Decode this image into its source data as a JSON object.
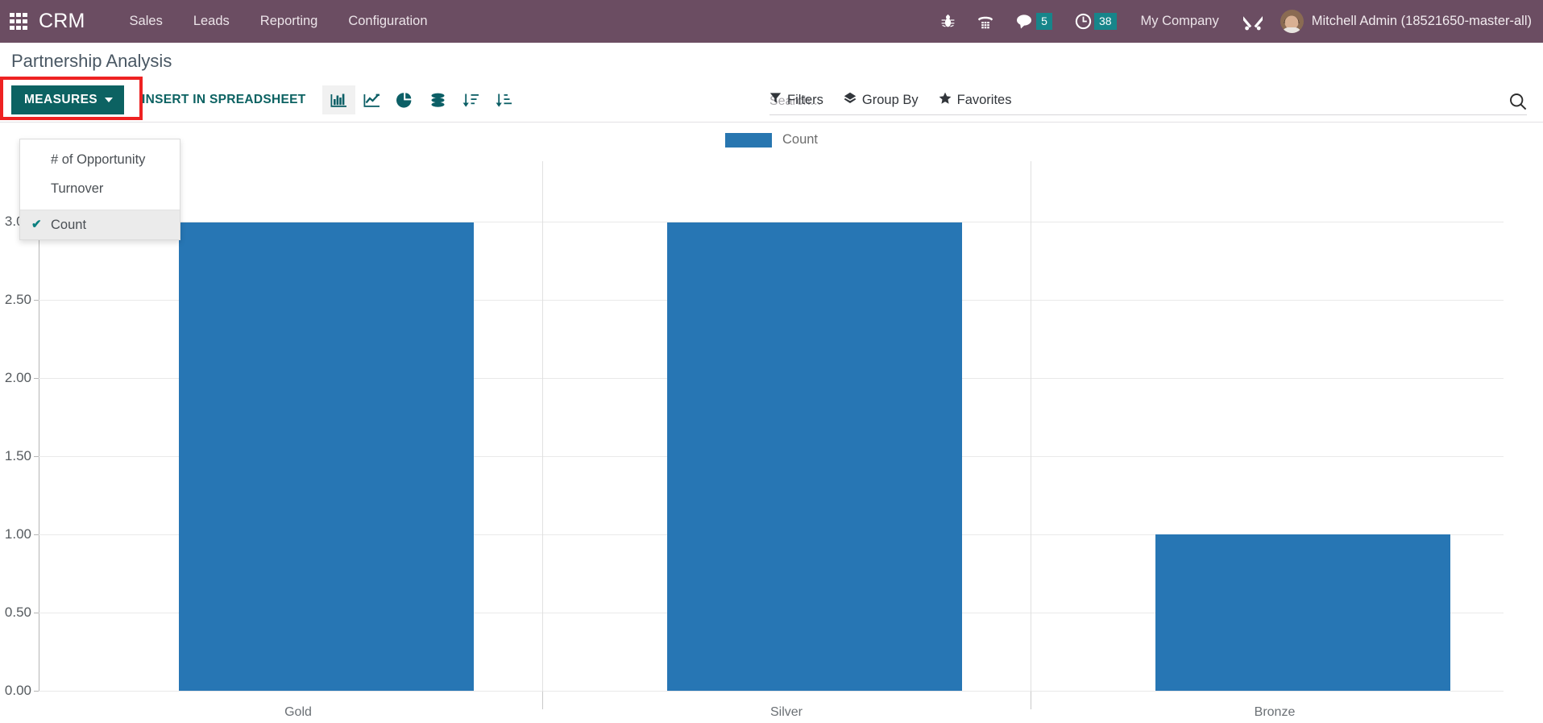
{
  "navbar": {
    "apps_icon": "apps-grid-icon",
    "brand": "CRM",
    "menu": [
      {
        "label": "Sales"
      },
      {
        "label": "Leads"
      },
      {
        "label": "Reporting"
      },
      {
        "label": "Configuration"
      }
    ],
    "icons": [
      {
        "name": "bug-icon",
        "title": "Debug"
      },
      {
        "name": "phone-dialpad-icon",
        "title": "VOIP"
      }
    ],
    "messages": {
      "name": "chat-bubble-icon",
      "count": "5"
    },
    "activities": {
      "name": "clock-icon",
      "count": "38"
    },
    "company": "My Company",
    "tools_icon": "tools-icon",
    "user": "Mitchell Admin (18521650-master-all)",
    "colors": {
      "background": "#6b4d62",
      "badge": "#17858a"
    }
  },
  "control_panel": {
    "page_title": "Partnership Analysis",
    "measures_button": "MEASURES",
    "insert_spreadsheet_button": "INSERT IN SPREADSHEET",
    "highlight_color": "#ee2222",
    "accent_color": "#0c6262",
    "view_switcher": [
      {
        "name": "bar-chart-icon",
        "label": "Bar Chart",
        "active": true
      },
      {
        "name": "line-chart-icon",
        "label": "Line Chart",
        "active": false
      },
      {
        "name": "pie-chart-icon",
        "label": "Pie Chart",
        "active": false
      },
      {
        "name": "stacked-icon",
        "label": "Stacked",
        "active": false
      },
      {
        "name": "sort-descending-icon",
        "label": "Descending",
        "active": false
      },
      {
        "name": "sort-ascending-icon",
        "label": "Ascending",
        "active": false
      }
    ]
  },
  "search": {
    "placeholder": "Search...",
    "value": "",
    "search_icon": "magnifier-icon",
    "options": [
      {
        "label": "Filters",
        "icon": "filter-funnel-icon"
      },
      {
        "label": "Group By",
        "icon": "chevrons-down-icon"
      },
      {
        "label": "Favorites",
        "icon": "star-icon"
      }
    ]
  },
  "measures_dropdown": {
    "open": true,
    "items": [
      {
        "label": "# of Opportunity",
        "selected": false
      },
      {
        "label": "Turnover",
        "selected": false
      },
      {
        "label": "Count",
        "selected": true
      }
    ],
    "check_glyph": "✔"
  },
  "chart_data": {
    "type": "bar",
    "title": "",
    "categories": [
      "Gold",
      "Silver",
      "Bronze"
    ],
    "series": [
      {
        "name": "Count",
        "values": [
          3,
          3,
          1
        ],
        "color": "#2776b4"
      }
    ],
    "values": [
      3,
      3,
      1
    ],
    "xlabel": "",
    "ylabel": "",
    "ylim": [
      0,
      3
    ],
    "yticks": [
      "0.00",
      "0.50",
      "1.00",
      "1.50",
      "2.00",
      "2.50",
      "3.00"
    ],
    "ytick_values": [
      0,
      0.5,
      1,
      1.5,
      2,
      2.5,
      3
    ],
    "grid": true,
    "legend": {
      "position": "top",
      "entries": [
        "Count"
      ]
    }
  }
}
